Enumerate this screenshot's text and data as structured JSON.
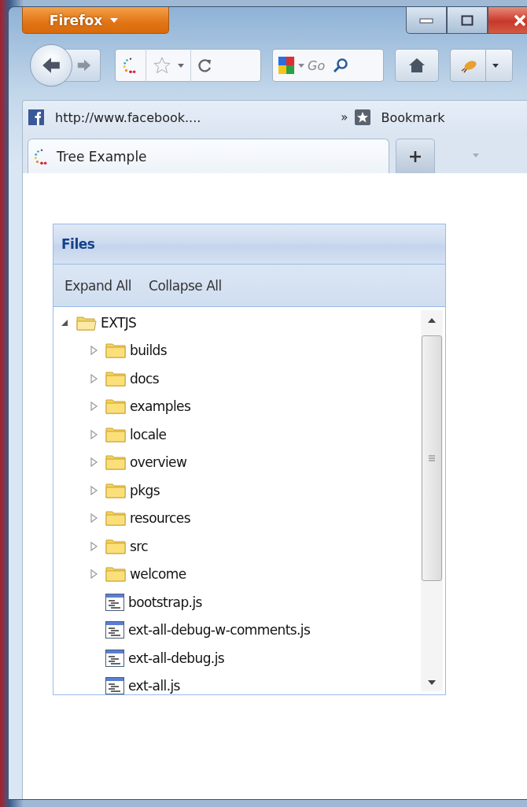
{
  "window": {
    "menu_button": "Firefox"
  },
  "navigation": {
    "search": {
      "placeholder": "Go"
    }
  },
  "bookmarks_bar": {
    "items": [
      {
        "label": "http://www.facebook...."
      }
    ],
    "overflow": "»",
    "bookmarks_menu": "Bookmark"
  },
  "tabs": [
    {
      "title": "Tree Example",
      "selected": true
    }
  ],
  "panel": {
    "title": "Files",
    "buttons": [
      "Expand All",
      "Collapse All"
    ],
    "tree": [
      {
        "label": "EXTJS",
        "kind": "folder",
        "expanded": true,
        "children": [
          {
            "label": "builds",
            "kind": "folder",
            "expanded": false
          },
          {
            "label": "docs",
            "kind": "folder",
            "expanded": false
          },
          {
            "label": "examples",
            "kind": "folder",
            "expanded": false
          },
          {
            "label": "locale",
            "kind": "folder",
            "expanded": false
          },
          {
            "label": "overview",
            "kind": "folder",
            "expanded": false
          },
          {
            "label": "pkgs",
            "kind": "folder",
            "expanded": false
          },
          {
            "label": "resources",
            "kind": "folder",
            "expanded": false
          },
          {
            "label": "src",
            "kind": "folder",
            "expanded": false
          },
          {
            "label": "welcome",
            "kind": "folder",
            "expanded": false
          },
          {
            "label": "bootstrap.js",
            "kind": "file"
          },
          {
            "label": "ext-all-debug-w-comments.js",
            "kind": "file"
          },
          {
            "label": "ext-all-debug.js",
            "kind": "file"
          },
          {
            "label": "ext-all.js",
            "kind": "file"
          }
        ]
      }
    ]
  }
}
